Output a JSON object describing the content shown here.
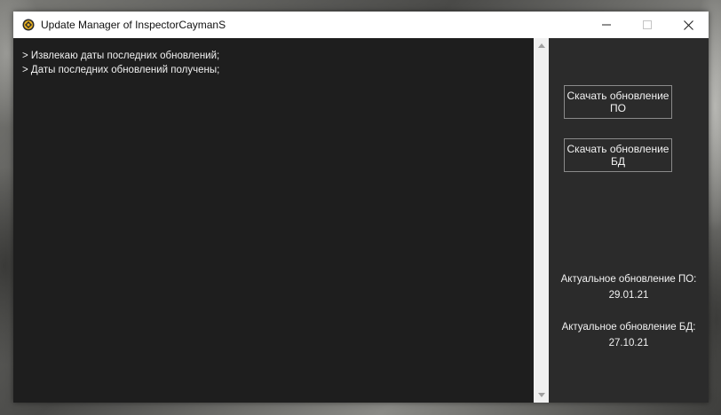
{
  "window": {
    "title": "Update Manager of InspectorCaymanS",
    "controls": {
      "minimize": "—",
      "maximize": "☐",
      "close": "✕"
    }
  },
  "console": {
    "lines": [
      "> Извлекаю даты последних обновлений;",
      "> Даты последних обновлений получены;"
    ]
  },
  "actions": {
    "download_software": "Скачать обновление ПО",
    "download_database": "Скачать обновление БД"
  },
  "info": {
    "software_label": "Актуальное обновление ПО:",
    "software_date": "29.01.21",
    "database_label": "Актуальное обновление БД:",
    "database_date": "27.10.21"
  }
}
